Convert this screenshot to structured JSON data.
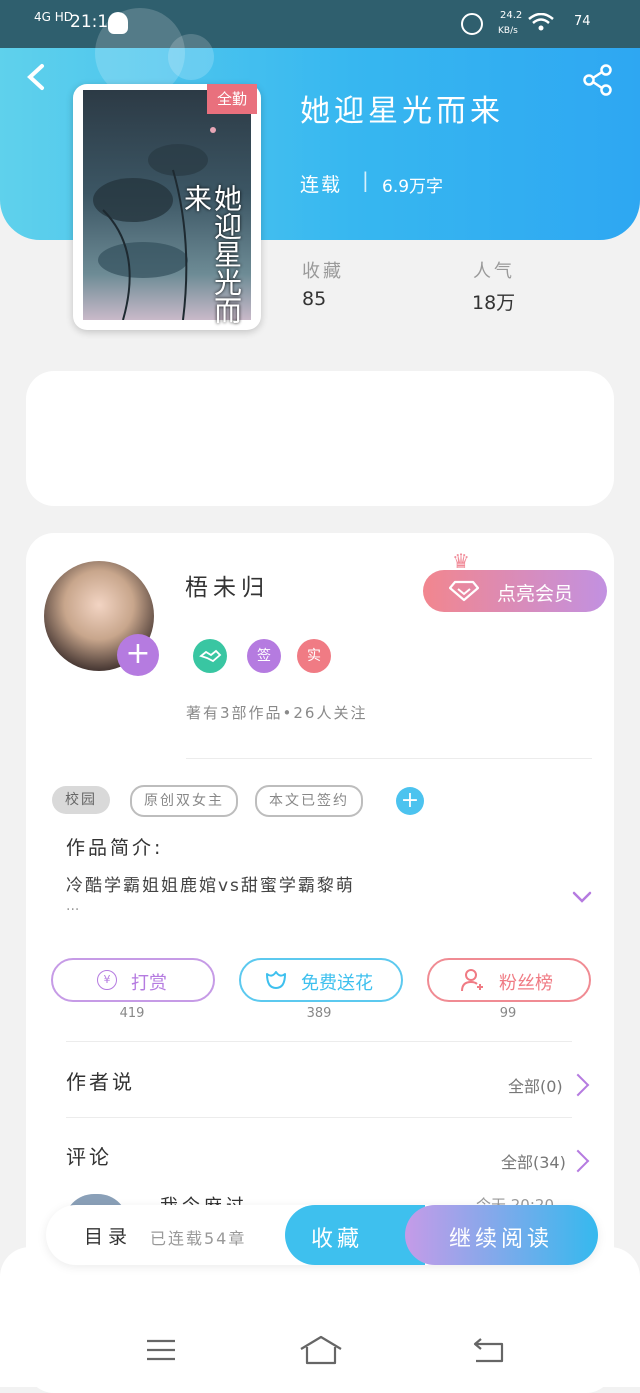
{
  "status_bar": {
    "network": "4G HD",
    "time": "21:10",
    "speed": "24.2",
    "speed_unit": "KB/s",
    "battery": "74"
  },
  "book": {
    "title": "她迎星光而来",
    "status": "连载",
    "word_count": "6.9万字",
    "cover_tag": "全勤",
    "cover_title": "她迎星光而来",
    "stats": [
      {
        "label": "收藏",
        "value": "85"
      },
      {
        "label": "人气",
        "value": "18万"
      }
    ]
  },
  "author": {
    "name": "梧未归",
    "meta": "著有3部作品•26人关注",
    "vip_button": "点亮会员",
    "badges": [
      {
        "label": "",
        "color": "#39c6a2",
        "icon": "handshake-icon"
      },
      {
        "label": "签",
        "color": "#b57be0"
      },
      {
        "label": "实",
        "color": "#f07b84"
      }
    ]
  },
  "tags": [
    "校园",
    "原创双女主",
    "本文已签约"
  ],
  "intro": {
    "label": "作品简介:",
    "text": "冷酷学霸姐姐鹿婠vs甜蜜学霸黎萌",
    "more": "..."
  },
  "actions": [
    {
      "label": "打赏",
      "count": "419",
      "color": "#b57be0"
    },
    {
      "label": "免费送花",
      "count": "389",
      "color": "#3ec0ee"
    },
    {
      "label": "粉丝榜",
      "count": "99",
      "color": "#f07b84"
    }
  ],
  "author_says": {
    "title": "作者说",
    "count_label": "全部(0)"
  },
  "comments": {
    "title": "评论",
    "count_label": "全部(34)",
    "partial_user": "我今麻过",
    "partial_time": "今天 20:20"
  },
  "bottom_bar": {
    "toc": "目录",
    "chapters": "已连载54章",
    "favorite": "收藏",
    "continue": "继续阅读"
  },
  "colors": {
    "header_start": "#5fd1ec",
    "header_end": "#2ea7f2",
    "accent_purple": "#b57be0",
    "accent_blue": "#3ec0ee",
    "accent_red": "#f07b84"
  }
}
